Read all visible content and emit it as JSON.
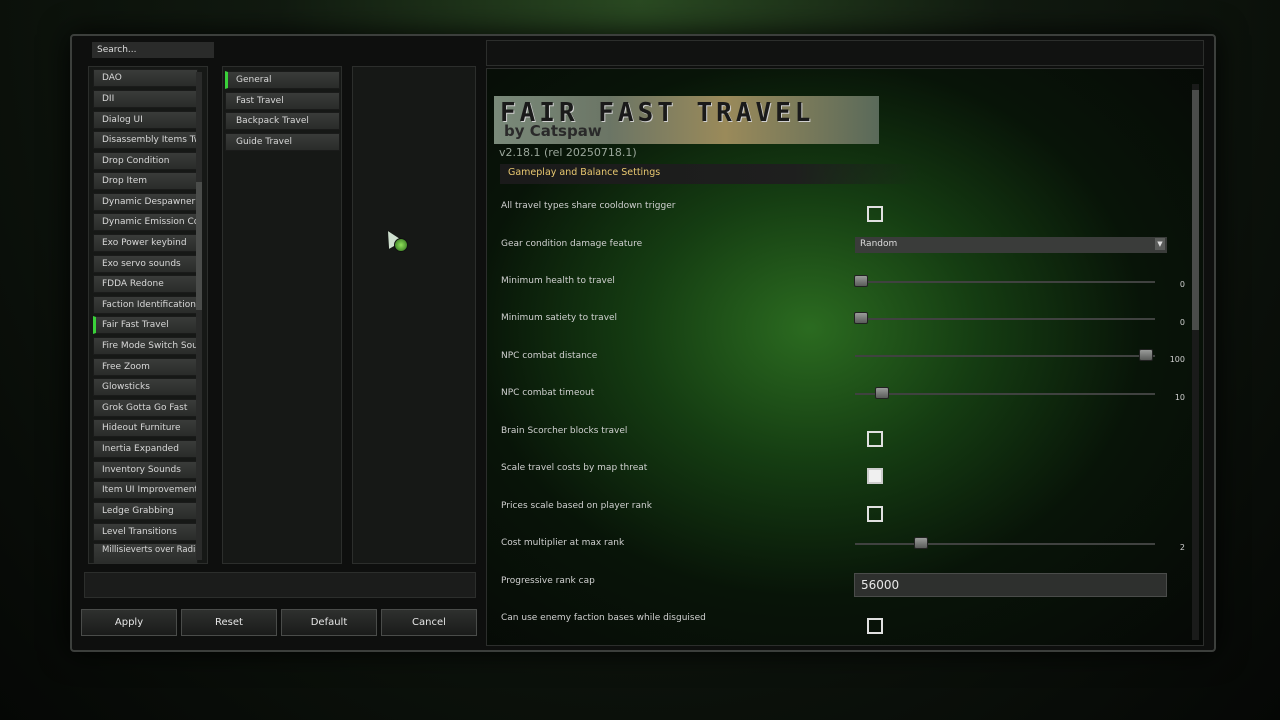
{
  "search": {
    "placeholder": "Search..."
  },
  "mods": [
    {
      "label": "DAO"
    },
    {
      "label": "DII"
    },
    {
      "label": "Dialog UI"
    },
    {
      "label": "Disassembly Items Tweak"
    },
    {
      "label": "Drop Condition"
    },
    {
      "label": "Drop Item"
    },
    {
      "label": "Dynamic Despawner"
    },
    {
      "label": "Dynamic Emission Cover"
    },
    {
      "label": "Exo Power keybind"
    },
    {
      "label": "Exo servo sounds"
    },
    {
      "label": "FDDA Redone"
    },
    {
      "label": "Faction Identification"
    },
    {
      "label": "Fair Fast Travel",
      "active": true
    },
    {
      "label": "Fire Mode Switch Sound"
    },
    {
      "label": "Free Zoom"
    },
    {
      "label": "Glowsticks"
    },
    {
      "label": "Grok Gotta Go Fast"
    },
    {
      "label": "Hideout Furniture"
    },
    {
      "label": "Inertia Expanded"
    },
    {
      "label": "Inventory Sounds"
    },
    {
      "label": "Item UI Improvements"
    },
    {
      "label": "Ledge Grabbing"
    },
    {
      "label": "Level Transitions"
    },
    {
      "label": "Millisieverts over Radiation Status Icon"
    }
  ],
  "tabs": [
    {
      "label": "General",
      "active": true
    },
    {
      "label": "Fast Travel"
    },
    {
      "label": "Backpack Travel"
    },
    {
      "label": "Guide Travel"
    }
  ],
  "buttons": {
    "apply": "Apply",
    "reset": "Reset",
    "default": "Default",
    "cancel": "Cancel"
  },
  "banner": {
    "title": "FAIR FAST TRAVEL",
    "byline": "by Catspaw"
  },
  "version": "v2.18.1 (rel 20250718.1)",
  "section_title": "Gameplay and Balance Settings",
  "settings": {
    "share_cooldown": {
      "label": "All travel types share cooldown trigger",
      "checked": false
    },
    "gear_damage": {
      "label": "Gear condition damage feature",
      "value": "Random"
    },
    "min_health": {
      "label": "Minimum health to travel",
      "value": "0",
      "fraction": 0.02
    },
    "min_satiety": {
      "label": "Minimum satiety to travel",
      "value": "0",
      "fraction": 0.02
    },
    "npc_distance": {
      "label": "NPC combat distance",
      "value": "100",
      "fraction": 0.97
    },
    "npc_timeout": {
      "label": "NPC combat timeout",
      "value": "10",
      "fraction": 0.09
    },
    "brain_scorcher": {
      "label": "Brain Scorcher blocks travel",
      "checked": false
    },
    "scale_costs": {
      "label": "Scale travel costs by map threat",
      "checked": true
    },
    "prices_scale": {
      "label": "Prices scale based on player rank",
      "checked": false
    },
    "cost_multiplier": {
      "label": "Cost multiplier at max rank",
      "value": "2",
      "fraction": 0.22
    },
    "rank_cap": {
      "label": "Progressive rank cap",
      "value": "56000"
    },
    "enemy_bases": {
      "label": "Can use enemy faction bases while disguised",
      "checked": false
    }
  },
  "dropdown_icon": "chevron-down-icon",
  "colors": {
    "accent": "#3ad13a",
    "section_text": "#e8c870"
  }
}
